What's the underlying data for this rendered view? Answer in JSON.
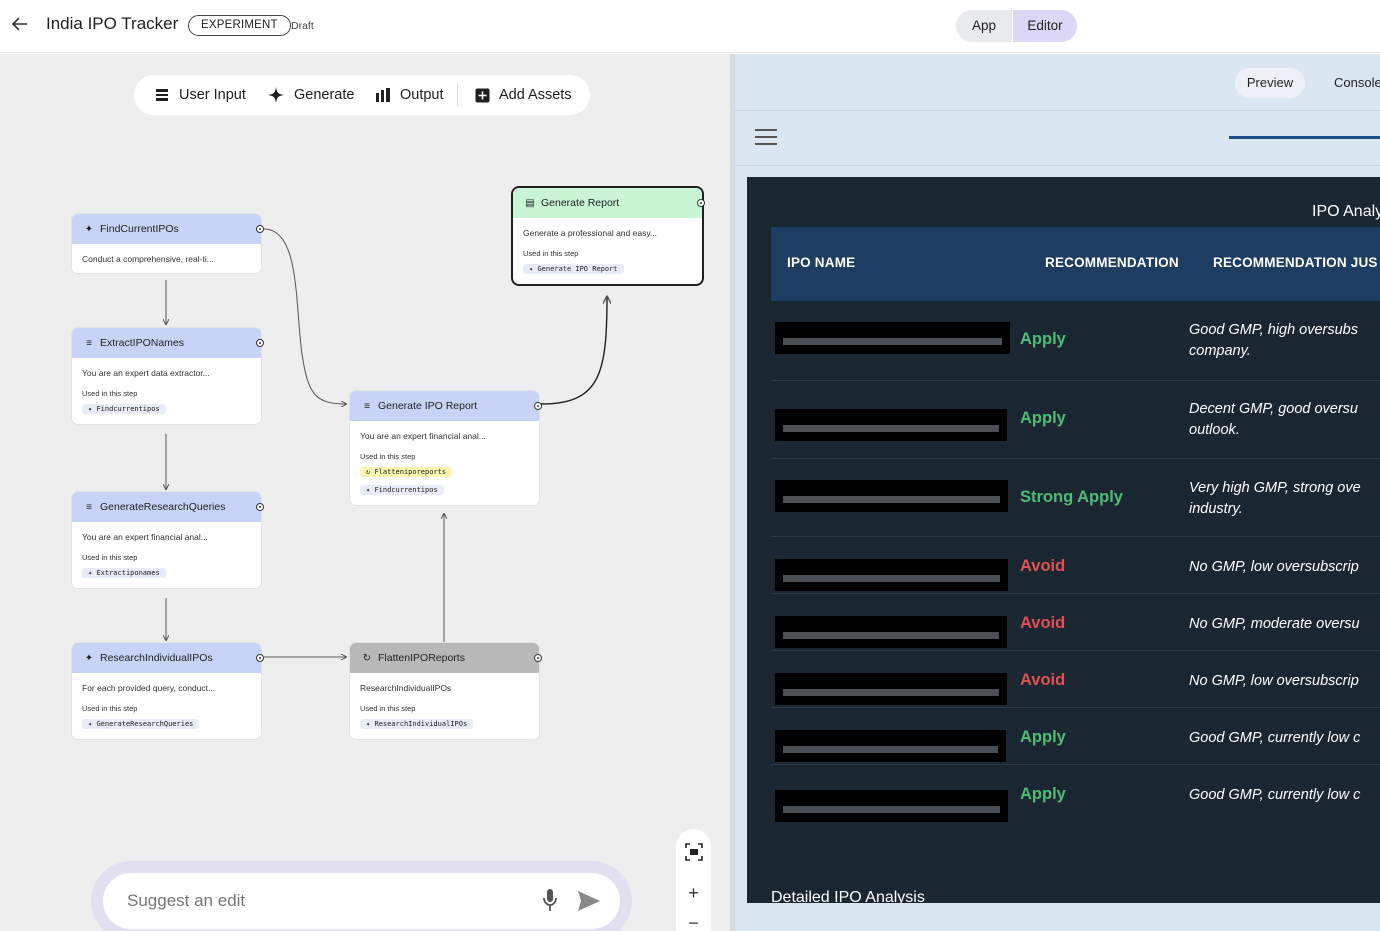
{
  "header": {
    "title": "India IPO Tracker",
    "badge": "EXPERIMENT",
    "status": "Draft",
    "mode_app": "App",
    "mode_editor": "Editor"
  },
  "toolbar": {
    "user_input": "User Input",
    "generate": "Generate",
    "output": "Output",
    "add_assets": "Add Assets"
  },
  "nodes": {
    "find": {
      "title": "FindCurrentIPOs",
      "desc": "Conduct a comprehensive, real-ti..."
    },
    "extract": {
      "title": "ExtractIPONames",
      "desc": "You are an expert data extractor...",
      "used": "Used in this step",
      "chip": "Findcurrentipos"
    },
    "queries": {
      "title": "GenerateResearchQueries",
      "desc": "You are an expert financial anal...",
      "used": "Used in this step",
      "chip": "Extractiponames"
    },
    "research": {
      "title": "ResearchIndividualIPOs",
      "desc": "For each provided query, conduct...",
      "used": "Used in this step",
      "chip": "GenerateResearchQueries"
    },
    "gen_ipo": {
      "title": "Generate IPO Report",
      "desc": "You are an expert financial anal...",
      "used": "Used in this step",
      "chip1": "Flatteniporeports",
      "chip2": "Findcurrentipos"
    },
    "flatten": {
      "title": "FlattenIPOReports",
      "desc": "ResearchIndividualIPOs",
      "used": "Used in this step",
      "chip": "ResearchIndividualIPOs"
    },
    "gen_report": {
      "title": "Generate Report",
      "desc": "Generate a professional and easy...",
      "used": "Used in this step",
      "chip": "Generate IPO Report"
    }
  },
  "suggest": {
    "placeholder": "Suggest an edit"
  },
  "preview": {
    "preview_label": "Preview",
    "console_label": "Console",
    "report_title": "IPO Analy",
    "columns": [
      "IPO NAME",
      "RECOMMENDATION",
      "RECOMMENDATION JUS"
    ],
    "rows": [
      {
        "recommendation": "Apply",
        "kind": "apply",
        "just1": "Good GMP, high oversubs",
        "just2": "company."
      },
      {
        "recommendation": "Apply",
        "kind": "apply",
        "just1": "Decent GMP, good oversu",
        "just2": "outlook."
      },
      {
        "recommendation": "Strong Apply",
        "kind": "strong",
        "just1": "Very high GMP, strong ove",
        "just2": "industry."
      },
      {
        "recommendation": "Avoid",
        "kind": "avoid",
        "just1": "No GMP, low oversubscrip",
        "just2": ""
      },
      {
        "recommendation": "Avoid",
        "kind": "avoid",
        "just1": "No GMP, moderate oversu",
        "just2": ""
      },
      {
        "recommendation": "Avoid",
        "kind": "avoid",
        "just1": "No GMP, low oversubscrip",
        "just2": ""
      },
      {
        "recommendation": "Apply",
        "kind": "apply",
        "just1": "Good GMP, currently low c",
        "just2": ""
      },
      {
        "recommendation": "Apply",
        "kind": "apply",
        "just1": "Good GMP, currently low c",
        "just2": ""
      }
    ],
    "detailed_title": "Detailed IPO Analysis"
  },
  "colors": {
    "apply": "#4dbd74",
    "avoid": "#e05252",
    "editor_accent": "#dcd7f7",
    "report_bg": "#1b2633",
    "table_header": "#1d3d63"
  }
}
